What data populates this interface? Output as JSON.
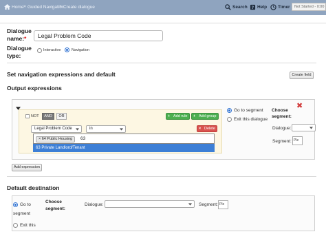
{
  "breadcrumb": {
    "items": [
      "Home",
      "Guided Navigation",
      "Create dialogue"
    ],
    "separator": "»"
  },
  "toolbar": {
    "search_label": "Search",
    "help_label": "Help",
    "timer_label": "Timer",
    "status_text": "Not Started - 0:00"
  },
  "form": {
    "name_label": "Dialogue name:",
    "required_mark": "*",
    "name_value": "Legal Problem Code",
    "type_label": "Dialogue type:",
    "type_options": [
      {
        "label": "Interactive",
        "selected": false
      },
      {
        "label": "Navigation",
        "selected": true
      }
    ]
  },
  "navigation": {
    "heading": "Set navigation expressions and default",
    "create_field_button": "Create field"
  },
  "output": {
    "heading": "Output expressions",
    "not_label": "NOT",
    "and_label": "AND",
    "or_label": "OR",
    "add_rule_button": "Add rule",
    "add_group_button": "Add group",
    "field_select": "Legal Problem Code",
    "operator_select": "in",
    "delete_button": "Delete",
    "token_value": "64 Public Housing",
    "token_remove": "×",
    "typed_value": "63",
    "suggestion": "63 Private Landlord/Tenant",
    "go_to_segment_label": "Go to segment",
    "exit_dialogue_label": "Exit this dialogue",
    "choose_segment_label": "Choose segment:",
    "dialogue_label": "Dialogue:",
    "segment_label": "Segment:",
    "segment_placeholder": "Ple",
    "add_expression_button": "Add expression",
    "remove_icon": "✖",
    "colors": {
      "add": "#4caf50",
      "delete": "#d9534f",
      "selected": "#3d7fd6",
      "group_bg": "#fdf7e3"
    }
  },
  "default_destination": {
    "heading": "Default destination",
    "go_to_label": "Go to",
    "segment_word": "segment",
    "choose_label": "Choose",
    "segment_colon": "segment:",
    "dialogue_label": "Dialogue:",
    "segment_label": "Segment:",
    "segment_placeholder": "Ple",
    "exit_label": "Exit this"
  }
}
